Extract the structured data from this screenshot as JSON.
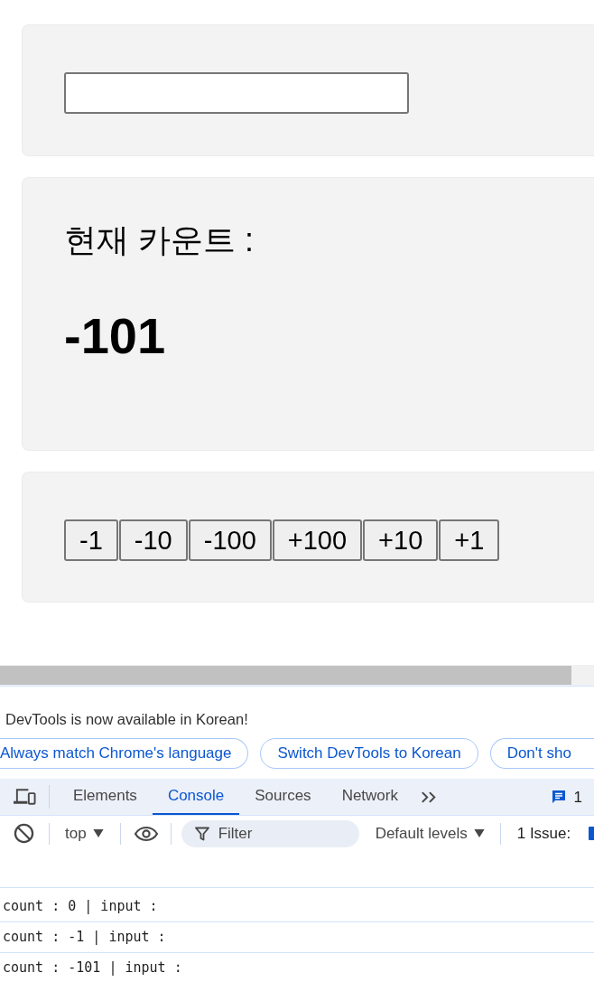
{
  "page": {
    "cards": [
      {
        "kind": "input"
      },
      {
        "kind": "counter",
        "label": "현재 카운트 :",
        "value": "-101"
      },
      {
        "kind": "buttons",
        "buttons": [
          "-1",
          "-10",
          "-100",
          "+100",
          "+10",
          "+1"
        ]
      }
    ]
  },
  "devtools": {
    "notice": "DevTools is now available in Korean!",
    "notice_buttons": [
      "Always match Chrome's language",
      "Switch DevTools to Korean",
      "Don't sho"
    ],
    "tabs": [
      {
        "label": "Elements",
        "selected": false
      },
      {
        "label": "Console",
        "selected": true
      },
      {
        "label": "Sources",
        "selected": false
      },
      {
        "label": "Network",
        "selected": false
      }
    ],
    "messages_count": "1",
    "toolbar": {
      "context": "top",
      "filter_placeholder": "Filter",
      "levels": "Default levels",
      "issues": "1 Issue:"
    },
    "console_rows": [
      "count : 0 | input :",
      "count : -1 | input :",
      "count : -101 | input :"
    ]
  }
}
